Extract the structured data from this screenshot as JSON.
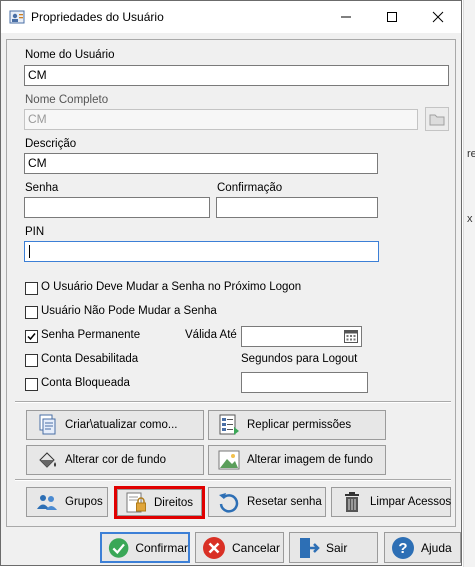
{
  "window": {
    "title": "Propriedades do Usuário",
    "controls": [
      "minimize-icon",
      "maximize-icon",
      "close-icon"
    ]
  },
  "form": {
    "username": {
      "label": "Nome do Usuário",
      "value": "CM"
    },
    "fullname": {
      "label": "Nome Completo",
      "value": "CM"
    },
    "description": {
      "label": "Descrição",
      "value": "CM"
    },
    "password": {
      "label": "Senha",
      "value": ""
    },
    "confirmation": {
      "label": "Confirmação",
      "value": ""
    },
    "pin": {
      "label": "PIN",
      "value": ""
    }
  },
  "options": {
    "must_change": {
      "label": "O Usuário Deve Mudar a Senha no Próximo Logon",
      "checked": false
    },
    "cannot_change": {
      "label": "Usuário Não Pode Mudar a Senha",
      "checked": false
    },
    "permanent": {
      "label": "Senha Permanente",
      "checked": true
    },
    "valid_until": {
      "label": "Válida Até",
      "value": ""
    },
    "disabled": {
      "label": "Conta Desabilitada",
      "checked": false
    },
    "locked": {
      "label": "Conta Bloqueada",
      "checked": false
    },
    "logout_seconds": {
      "label": "Segundos para Logout",
      "value": ""
    }
  },
  "actions": {
    "create_update": "Criar\\atualizar como...",
    "replicate": "Replicar permissões",
    "bg_color": "Alterar cor de fundo",
    "bg_image": "Alterar imagem de fundo",
    "groups": "Grupos",
    "rights": "Direitos",
    "reset_password": "Resetar senha",
    "clear_access": "Limpar Acessos"
  },
  "footer": {
    "confirm": "Confirmar",
    "cancel": "Cancelar",
    "exit": "Sair",
    "help": "Ajuda"
  },
  "colors": {
    "highlight": "#e00000",
    "focus": "#3c7fd6",
    "confirm_green": "#3aa757",
    "cancel_red": "#d93025",
    "help_blue": "#2d6fb5"
  }
}
